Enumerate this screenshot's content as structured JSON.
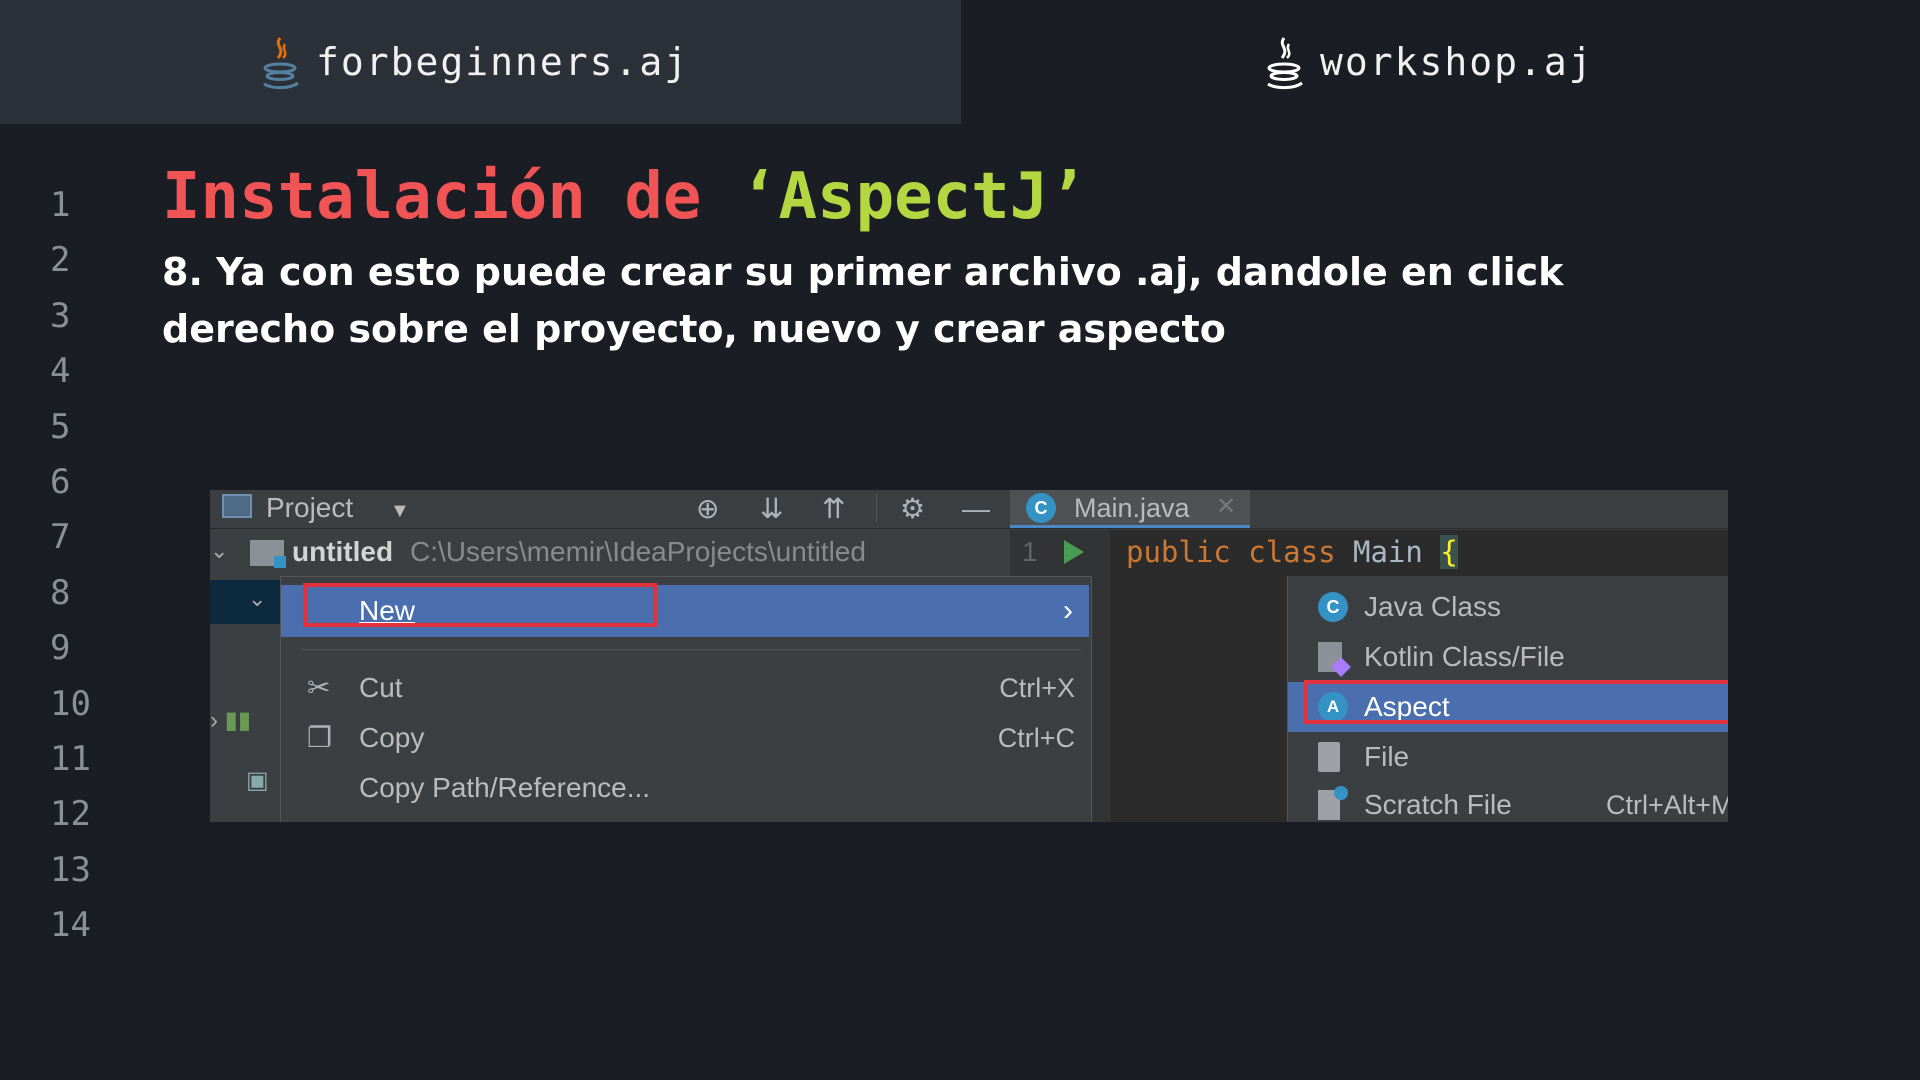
{
  "tabs": [
    {
      "label": "forbeginners.aj",
      "active": true
    },
    {
      "label": "workshop.aj",
      "active": false
    }
  ],
  "line_numbers": [
    "1",
    "2",
    "3",
    "4",
    "5",
    "6",
    "7",
    "8",
    "9",
    "10",
    "11",
    "12",
    "13",
    "14"
  ],
  "heading": {
    "part1": "Instalación de ",
    "part2": "‘AspectJ’",
    "color_part1": "#f15454",
    "color_part2": "#b4d641"
  },
  "description": "8. Ya con esto puede crear su primer archivo .aj, dandole en click derecho sobre el proyecto, nuevo y crear aspecto",
  "ide": {
    "toolbar": {
      "project_label": "Project",
      "editor_tab": "Main.java",
      "editor_tab_badge": "C"
    },
    "tree": {
      "project_name": "untitled",
      "project_path": "C:\\Users\\memir\\IdeaProjects\\untitled"
    },
    "editor": {
      "line_number": "1",
      "kw_public": "public",
      "kw_class": "class",
      "class_name": "Main",
      "brace": "{"
    },
    "context_menu": {
      "new_label": "New",
      "new_arrow": "›",
      "items": [
        {
          "label": "Cut",
          "shortcut": "Ctrl+X",
          "icon": "scissors-icon"
        },
        {
          "label": "Copy",
          "shortcut": "Ctrl+C",
          "icon": "copy-icon"
        },
        {
          "label": "Copy Path/Reference...",
          "shortcut": "",
          "icon": ""
        }
      ]
    },
    "submenu": {
      "items": [
        {
          "label": "Java Class",
          "badge": "C",
          "icon": "java-class-icon"
        },
        {
          "label": "Kotlin Class/File",
          "icon": "kotlin-file-icon"
        },
        {
          "label": "Aspect",
          "badge": "A",
          "icon": "aspect-icon",
          "selected": true
        },
        {
          "label": "File",
          "icon": "file-icon"
        },
        {
          "label": "Scratch File",
          "shortcut": "Ctrl+Alt+Mayús+Insertar",
          "icon": "scratch-file-icon"
        }
      ]
    },
    "highlight_color": "#e0313c",
    "selection_color": "#4b6eaf"
  }
}
